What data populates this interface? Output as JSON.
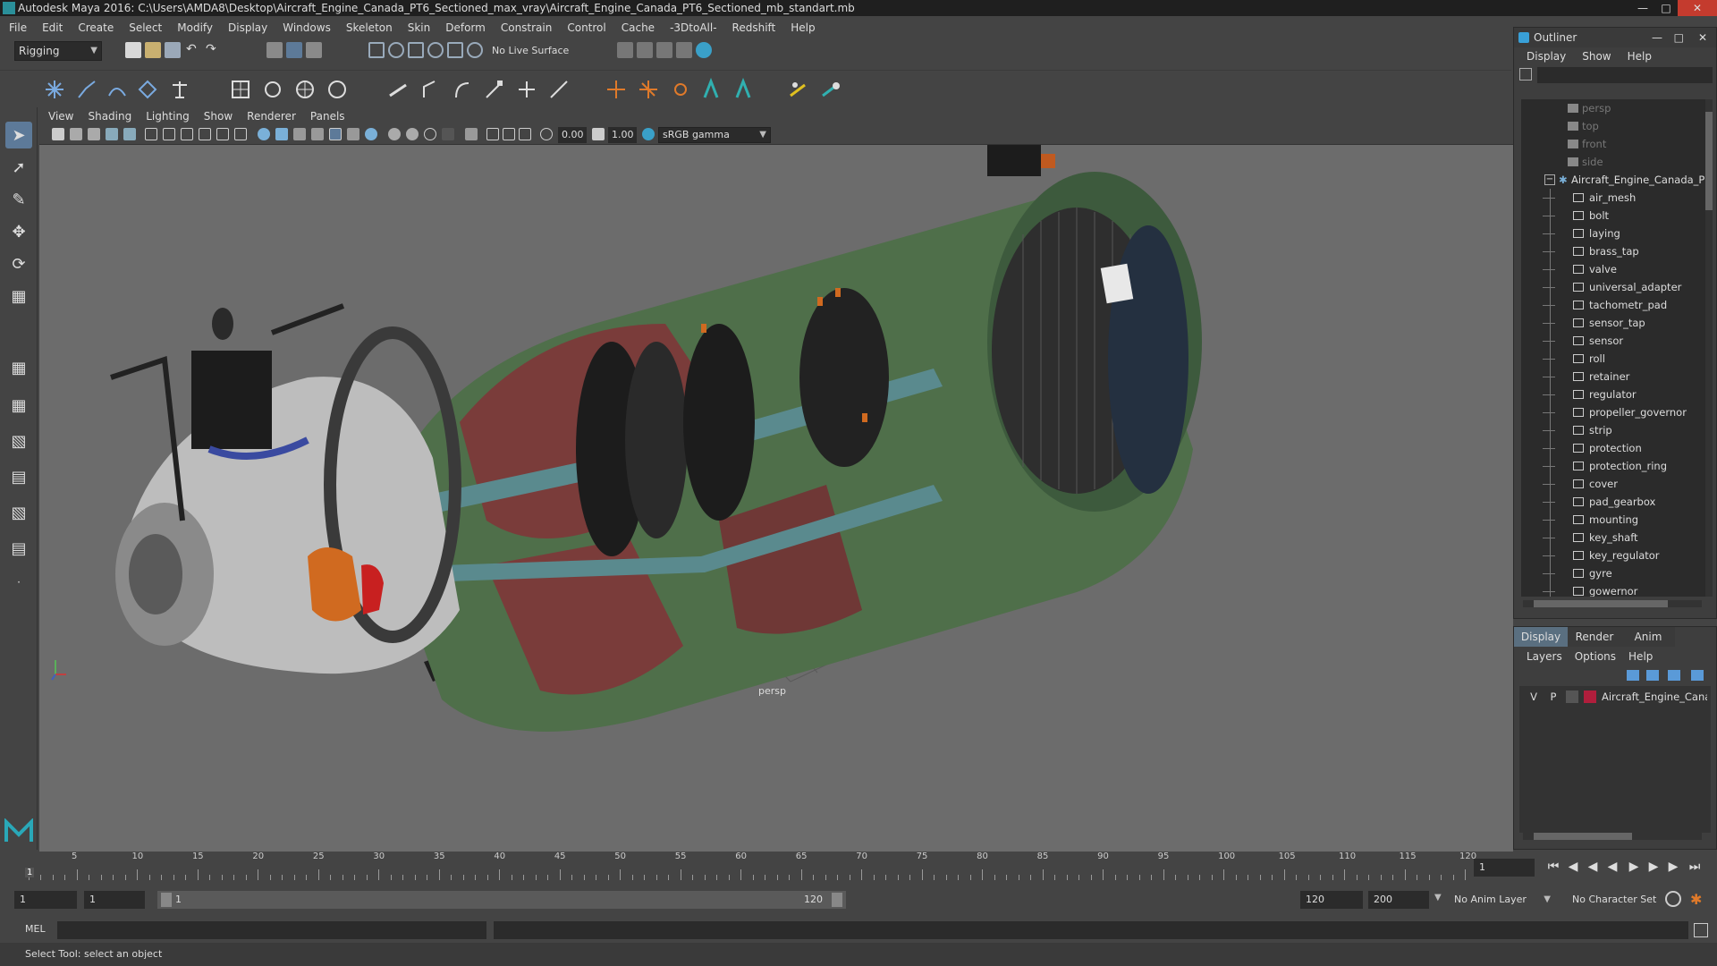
{
  "window": {
    "title": "Autodesk Maya 2016: C:\\Users\\AMDA8\\Desktop\\Aircraft_Engine_Canada_PT6_Sectioned_max_vray\\Aircraft_Engine_Canada_PT6_Sectioned_mb_standart.mb"
  },
  "menubar": [
    "File",
    "Edit",
    "Create",
    "Select",
    "Modify",
    "Display",
    "Windows",
    "Skeleton",
    "Skin",
    "Deform",
    "Constrain",
    "Control",
    "Cache",
    "-3DtoAll-",
    "Redshift",
    "Help"
  ],
  "statusline": {
    "menuset": "Rigging",
    "live_surface": "No Live Surface"
  },
  "panel": {
    "menus": [
      "View",
      "Shading",
      "Lighting",
      "Show",
      "Renderer",
      "Panels"
    ],
    "exposure": "0.00",
    "gamma": "1.00",
    "colorspace": "sRGB gamma",
    "camera": "persp"
  },
  "outliner": {
    "title": "Outliner",
    "menus": [
      "Display",
      "Show",
      "Help"
    ],
    "cameras": [
      "persp",
      "top",
      "front",
      "side"
    ],
    "root": "Aircraft_Engine_Canada_P",
    "children": [
      "air_mesh",
      "bolt",
      "laying",
      "brass_tap",
      "valve",
      "universal_adapter",
      "tachometr_pad",
      "sensor_tap",
      "sensor",
      "roll",
      "retainer",
      "regulator",
      "propeller_governor",
      "strip",
      "protection",
      "protection_ring",
      "cover",
      "pad_gearbox",
      "mounting",
      "key_shaft",
      "key_regulator",
      "gyre",
      "gowernor"
    ]
  },
  "layers": {
    "tabs": [
      "Display",
      "Render",
      "Anim"
    ],
    "menus": [
      "Layers",
      "Options",
      "Help"
    ],
    "row": {
      "v": "V",
      "p": "P",
      "name": "Aircraft_Engine_Canac",
      "color": "#b01e3c"
    }
  },
  "timeline": {
    "ticks": [
      "5",
      "10",
      "15",
      "20",
      "25",
      "30",
      "35",
      "40",
      "45",
      "50",
      "55",
      "60",
      "65",
      "70",
      "75",
      "80",
      "85",
      "90",
      "95",
      "100",
      "105",
      "110",
      "115",
      "120"
    ],
    "current_frame": "1",
    "start_marker": "1"
  },
  "range": {
    "start": "1",
    "playback_start": "1",
    "slider_start": "1",
    "slider_end": "120",
    "playback_end": "120",
    "end": "200",
    "anim_layer": "No Anim Layer",
    "character_set": "No Character Set"
  },
  "cmdline": {
    "label": "MEL"
  },
  "helpline": "Select Tool: select an object",
  "colors": {
    "accent": "#5d7a99",
    "close": "#c43b2e"
  }
}
